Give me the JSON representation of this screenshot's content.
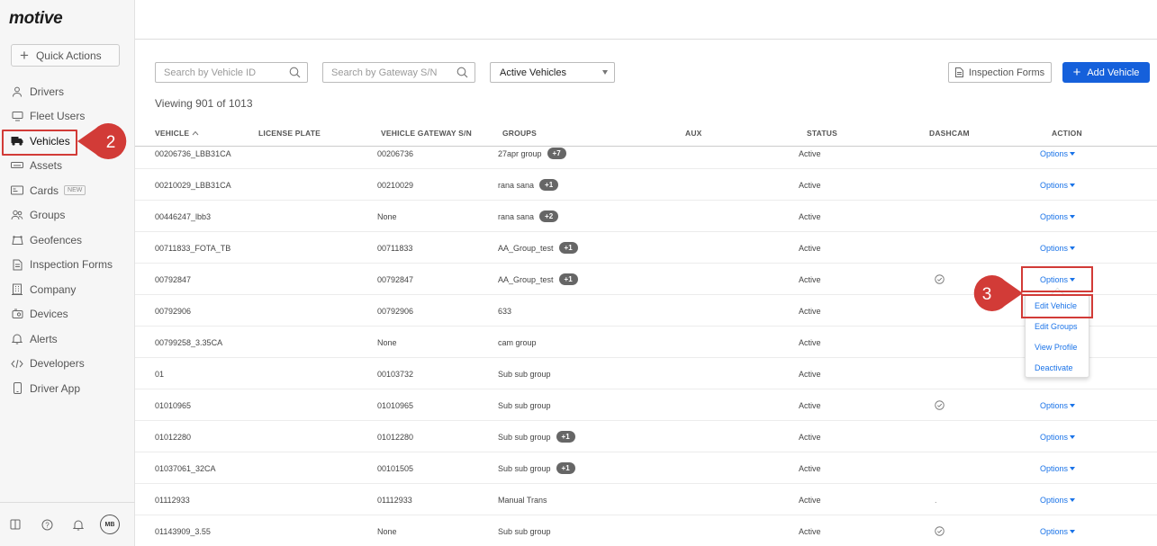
{
  "brand": {
    "logo": "motive"
  },
  "sidebar": {
    "quick_actions": "Quick Actions",
    "items": [
      {
        "label": "Drivers",
        "icon": "person-icon"
      },
      {
        "label": "Fleet Users",
        "icon": "monitor-icon"
      },
      {
        "label": "Vehicles",
        "icon": "truck-icon",
        "active": true
      },
      {
        "label": "Assets",
        "icon": "trailer-icon"
      },
      {
        "label": "Cards",
        "icon": "card-icon",
        "badge": "NEW"
      },
      {
        "label": "Groups",
        "icon": "users-icon"
      },
      {
        "label": "Geofences",
        "icon": "geofence-icon"
      },
      {
        "label": "Inspection Forms",
        "icon": "document-icon"
      },
      {
        "label": "Company",
        "icon": "building-icon"
      },
      {
        "label": "Devices",
        "icon": "device-icon"
      },
      {
        "label": "Alerts",
        "icon": "bell-icon"
      },
      {
        "label": "Developers",
        "icon": "code-icon"
      },
      {
        "label": "Driver App",
        "icon": "phone-icon"
      }
    ],
    "footer": {
      "avatar_initials": "MB"
    }
  },
  "toolbar": {
    "search_vehicle_placeholder": "Search by Vehicle ID",
    "search_gateway_placeholder": "Search by Gateway S/N",
    "status_filter": "Active Vehicles",
    "inspection_forms_label": "Inspection Forms",
    "add_vehicle_label": "Add Vehicle"
  },
  "summary": {
    "viewing": "Viewing 901 of 1013"
  },
  "table": {
    "headers": {
      "vehicle": "VEHICLE",
      "license_plate": "LICENSE PLATE",
      "gateway": "VEHICLE GATEWAY S/N",
      "groups": "GROUPS",
      "aux": "AUX",
      "status": "STATUS",
      "dashcam": "DASHCAM",
      "action": "ACTION"
    },
    "rows": [
      {
        "vehicle": "00206736_LBB31CA",
        "gateway": "00206736",
        "group": "27apr group",
        "extra": "+7",
        "status": "Active",
        "dashcam": false,
        "action": "Options"
      },
      {
        "vehicle": "00210029_LBB31CA",
        "gateway": "00210029",
        "group": "rana sana",
        "extra": "+1",
        "status": "Active",
        "dashcam": false,
        "action": "Options"
      },
      {
        "vehicle": "00446247_lbb3",
        "gateway": "None",
        "group": "rana sana",
        "extra": "+2",
        "status": "Active",
        "dashcam": false,
        "action": "Options"
      },
      {
        "vehicle": "00711833_FOTA_TB",
        "gateway": "00711833",
        "group": "AA_Group_test",
        "extra": "+1",
        "status": "Active",
        "dashcam": false,
        "action": "Options"
      },
      {
        "vehicle": "00792847",
        "gateway": "00792847",
        "group": "AA_Group_test",
        "extra": "+1",
        "status": "Active",
        "dashcam": true,
        "action": "Options"
      },
      {
        "vehicle": "00792906",
        "gateway": "00792906",
        "group": "633",
        "extra": "",
        "status": "Active",
        "dashcam": false,
        "action": ""
      },
      {
        "vehicle": "00799258_3.35CA",
        "gateway": "None",
        "group": "cam group",
        "extra": "",
        "status": "Active",
        "dashcam": false,
        "action": ""
      },
      {
        "vehicle": "01",
        "gateway": "00103732",
        "group": "Sub sub group",
        "extra": "",
        "status": "Active",
        "dashcam": false,
        "action": ""
      },
      {
        "vehicle": "01010965",
        "gateway": "01010965",
        "group": "Sub sub group",
        "extra": "",
        "status": "Active",
        "dashcam": true,
        "action": "Options"
      },
      {
        "vehicle": "01012280",
        "gateway": "01012280",
        "group": "Sub sub group",
        "extra": "+1",
        "status": "Active",
        "dashcam": false,
        "action": "Options"
      },
      {
        "vehicle": "01037061_32CA",
        "gateway": "00101505",
        "group": "Sub sub group",
        "extra": "+1",
        "status": "Active",
        "dashcam": false,
        "action": "Options"
      },
      {
        "vehicle": "01112933",
        "gateway": "01112933",
        "group": "Manual Trans",
        "extra": "",
        "status": "Active",
        "dashcam": false,
        "dashcam_mark": ".",
        "action": "Options"
      },
      {
        "vehicle": "01143909_3.55",
        "gateway": "None",
        "group": "Sub sub group",
        "extra": "",
        "status": "Active",
        "dashcam": true,
        "action": "Options"
      }
    ]
  },
  "options_menu": {
    "items": [
      "Edit Vehicle",
      "Edit Groups",
      "View Profile",
      "Deactivate"
    ]
  },
  "annotations": {
    "step_vehicles": "2",
    "step_edit": "3"
  },
  "colors": {
    "accent": "#1560db",
    "link": "#1a73e8",
    "annotation": "#d23b37"
  }
}
